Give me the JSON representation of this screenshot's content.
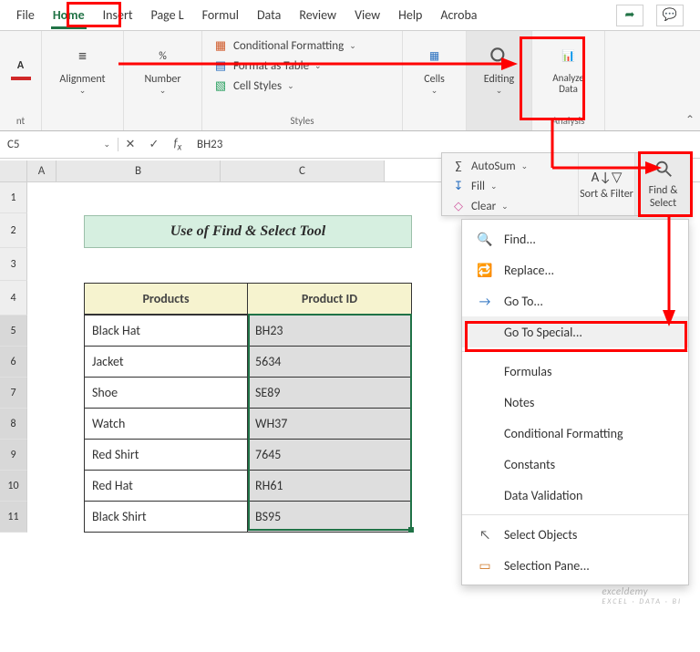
{
  "tabs": {
    "file": "File",
    "home": "Home",
    "insert": "Insert",
    "page_layout": "Page L",
    "formulas": "Formul",
    "data": "Data",
    "review": "Review",
    "view": "View",
    "help": "Help",
    "acrobat": "Acroba"
  },
  "ribbon": {
    "font_group": "nt",
    "alignment": "Alignment",
    "number": "Number",
    "cond_fmt": "Conditional Formatting",
    "fmt_table": "Format as Table",
    "cell_styles": "Cell Styles",
    "styles": "Styles",
    "cells": "Cells",
    "editing": "Editing",
    "analyze": "Analyze Data",
    "analysis": "Analysis"
  },
  "editing_panel": {
    "autosum": "AutoSum",
    "fill": "Fill",
    "clear": "Clear",
    "sort_filter": "Sort & Filter",
    "find_select": "Find & Select"
  },
  "fs_menu": {
    "find": "Find...",
    "replace": "Replace...",
    "goto": "Go To...",
    "goto_special": "Go To Special...",
    "formulas": "Formulas",
    "notes": "Notes",
    "cond_fmt": "Conditional Formatting",
    "constants": "Constants",
    "data_val": "Data Validation",
    "select_obj": "Select Objects",
    "sel_pane": "Selection Pane..."
  },
  "namebox": "C5",
  "formula_value": "BH23",
  "col_labels": {
    "A": "A",
    "B": "B",
    "C": "C"
  },
  "row_labels": [
    "1",
    "2",
    "3",
    "4",
    "5",
    "6",
    "7",
    "8",
    "9",
    "10",
    "11"
  ],
  "table": {
    "title": "Use of Find & Select Tool",
    "headers": {
      "products": "Products",
      "product_id": "Product ID"
    },
    "rows": [
      {
        "product": "Black Hat",
        "id": "BH23"
      },
      {
        "product": "Jacket",
        "id": "5634"
      },
      {
        "product": "Shoe",
        "id": "SE89"
      },
      {
        "product": "Watch",
        "id": "WH37"
      },
      {
        "product": "Red Shirt",
        "id": "7645"
      },
      {
        "product": "Red Hat",
        "id": "RH61"
      },
      {
        "product": "Black Shirt",
        "id": "BS95"
      }
    ]
  },
  "watermark": {
    "brand": "exceldemy",
    "tag": "EXCEL · DATA · BI"
  }
}
